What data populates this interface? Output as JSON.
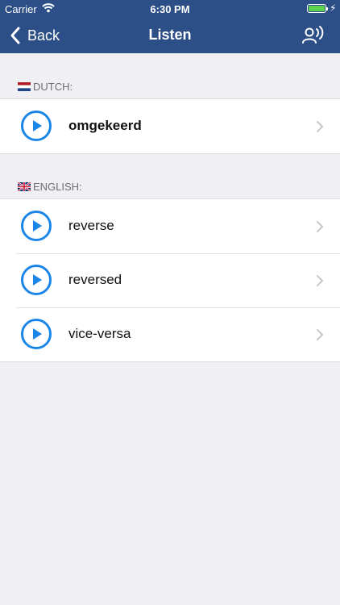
{
  "status_bar": {
    "carrier": "Carrier",
    "time": "6:30 PM"
  },
  "nav": {
    "back_label": "Back",
    "title": "Listen"
  },
  "sections": [
    {
      "header": "DUTCH:",
      "flag": "netherlands-flag",
      "items": [
        {
          "word": "omgekeerd"
        }
      ]
    },
    {
      "header": "ENGLISH:",
      "flag": "uk-flag",
      "items": [
        {
          "word": "reverse"
        },
        {
          "word": "reversed"
        },
        {
          "word": "vice-versa"
        }
      ]
    }
  ],
  "colors": {
    "nav_bg": "#2d4f87",
    "accent": "#1a86e8",
    "page_bg": "#efeff4"
  }
}
